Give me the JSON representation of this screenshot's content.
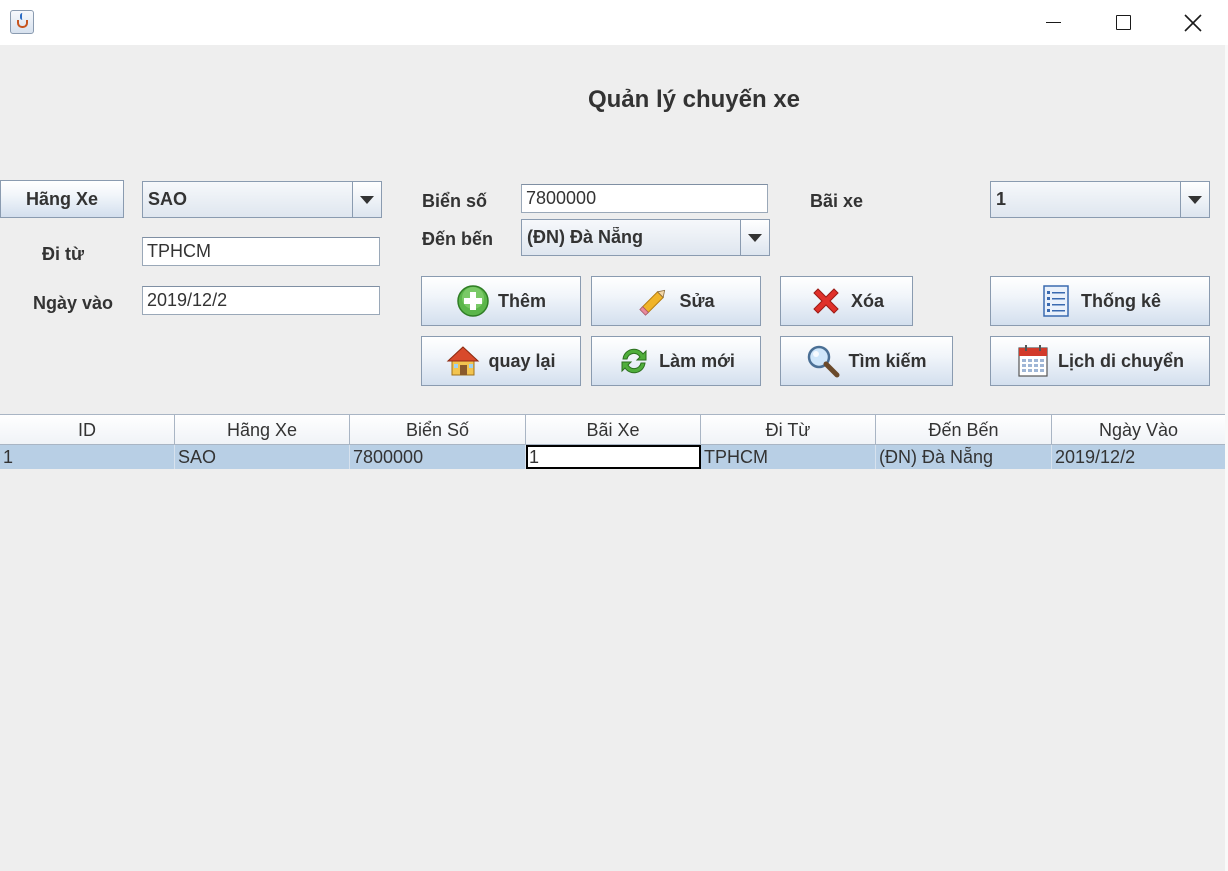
{
  "window": {
    "title": "",
    "icon": "java-cup-icon"
  },
  "page_title": "Quản lý chuyến xe",
  "form": {
    "hang_xe_button": "Hãng Xe",
    "hang_xe_value": "SAO",
    "di_tu_label": "Đi từ",
    "di_tu_value": "TPHCM",
    "ngay_vao_label": "Ngày vào",
    "ngay_vao_value": "2019/12/2",
    "bien_so_label": "Biển số",
    "bien_so_value": "7800000",
    "den_ben_label": "Đến bến",
    "den_ben_value": "(ĐN) Đà Nẵng",
    "bai_xe_label": "Bãi xe",
    "bai_xe_value": "1"
  },
  "buttons": {
    "them": "Thêm",
    "sua": "Sửa",
    "xoa": "Xóa",
    "thong_ke": "Thống kê",
    "quay_lai": "quay lại",
    "lam_moi": "Làm mới",
    "tim_kiem": "Tìm kiếm",
    "lich_di_chuyen": "Lịch di chuyển"
  },
  "table": {
    "columns": [
      "ID",
      "Hãng Xe",
      "Biển Số",
      "Bãi Xe",
      "Đi Từ",
      "Đến Bến",
      "Ngày Vào"
    ],
    "rows": [
      [
        "1",
        "SAO",
        "7800000",
        "1",
        "TPHCM",
        "(ĐN) Đà Nẵng",
        "2019/12/2"
      ]
    ]
  },
  "colors": {
    "accent_selection": "#b8cfe5",
    "button_border": "#8a9bb0",
    "background": "#eeeeee"
  }
}
